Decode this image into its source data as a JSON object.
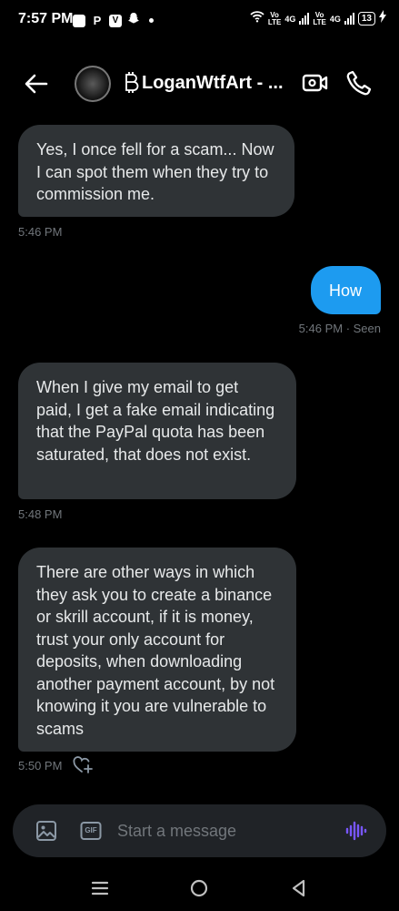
{
  "status": {
    "time": "7:57 PM",
    "left_icons": [
      "notification-square",
      "P",
      "V",
      "snapchat"
    ],
    "net1_top": "Vo",
    "net1_bottom": "LTE",
    "net1_gen": "4G",
    "net2_top": "Vo",
    "net2_bottom": "LTE",
    "net2_gen": "4G",
    "battery": "13"
  },
  "header": {
    "contact_name": "LoganWtfArt - ..."
  },
  "messages": [
    {
      "direction": "in",
      "text": "Yes, I once fell for a scam... Now I can spot them when they try to commission me.",
      "time": "5:46 PM"
    },
    {
      "direction": "out",
      "text": "How",
      "time": "5:46 PM · Seen"
    },
    {
      "direction": "in",
      "text": "When I give my email to get paid, I get a fake email indicating that the PayPal quota has been saturated, that does not exist.",
      "time": "5:48 PM"
    },
    {
      "direction": "in",
      "text": "There are other ways in which they ask you to create a binance or skrill account, if it is money, trust your only account for deposits, when downloading another payment account, by not knowing it you are vulnerable to scams",
      "time": "5:50 PM"
    }
  ],
  "composer": {
    "placeholder": "Start a message",
    "gif_label": "GIF"
  },
  "colors": {
    "background": "#000000",
    "incoming_bubble": "#2f3336",
    "outgoing_bubble": "#1d9bf0",
    "accent_voice": "#7856ff"
  },
  "icons": [
    "back-arrow",
    "video-call",
    "phone",
    "image",
    "gif",
    "voice-wave",
    "heart-plus",
    "menu",
    "home-circle",
    "back-triangle"
  ]
}
